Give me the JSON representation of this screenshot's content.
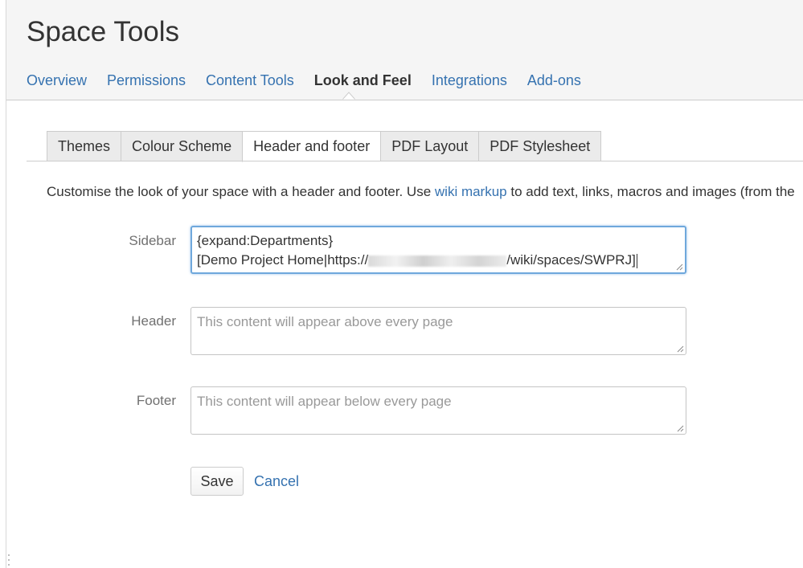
{
  "header": {
    "title": "Space Tools",
    "nav": [
      "Overview",
      "Permissions",
      "Content Tools",
      "Look and Feel",
      "Integrations",
      "Add-ons"
    ],
    "active_nav": "Look and Feel"
  },
  "tabs": [
    "Themes",
    "Colour Scheme",
    "Header and footer",
    "PDF Layout",
    "PDF Stylesheet"
  ],
  "active_tab": "Header and footer",
  "description": {
    "before": "Customise the look of your space with a header and footer. Use ",
    "link": "wiki markup",
    "after": " to add text, links, macros and images (from the"
  },
  "form": {
    "sidebar": {
      "label": "Sidebar",
      "line1": "{expand:Departments}",
      "line2_prefix": "[Demo Project Home|https://",
      "line2_suffix": "/wiki/spaces/SWPRJ]"
    },
    "header": {
      "label": "Header",
      "placeholder": "This content will appear above every page"
    },
    "footer": {
      "label": "Footer",
      "placeholder": "This content will appear below every page"
    },
    "save_label": "Save",
    "cancel_label": "Cancel"
  },
  "colors": {
    "link": "#3572b0",
    "focus": "#6fa8dc"
  }
}
